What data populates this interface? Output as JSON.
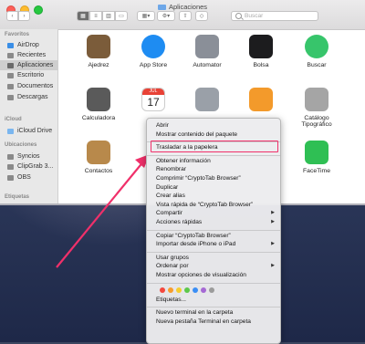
{
  "window": {
    "title": "Aplicaciones"
  },
  "search": {
    "placeholder": "Buscar"
  },
  "sidebar": {
    "sections": [
      {
        "title": "Favoritos",
        "items": [
          "AirDrop",
          "Recientes",
          "Aplicaciones",
          "Escritorio",
          "Documentos",
          "Descargas"
        ]
      },
      {
        "title": "iCloud",
        "items": [
          "iCloud Drive"
        ]
      },
      {
        "title": "Ubicaciones",
        "items": [
          "Syncios",
          "ClipGrab 3...",
          "OBS"
        ]
      },
      {
        "title": "Etiquetas",
        "items": []
      }
    ],
    "selected": "Aplicaciones"
  },
  "apps": [
    {
      "label": "Ajedrez",
      "icon": "chess-knight-icon",
      "color": "#7b5c3a"
    },
    {
      "label": "App Store",
      "icon": "app-store-icon",
      "color": "#1e8cf2"
    },
    {
      "label": "Automator",
      "icon": "automator-robot-icon",
      "color": "#8a8f98"
    },
    {
      "label": "Bolsa",
      "icon": "stocks-chart-icon",
      "color": "#1c1c1e"
    },
    {
      "label": "Buscar",
      "icon": "find-my-radar-icon",
      "color": "#37c56b"
    },
    {
      "label": "Calculadora",
      "icon": "calculator-icon",
      "color": "#5a5a5a"
    },
    {
      "label": "",
      "icon": "calendar-icon",
      "color": "#e84236",
      "day": "17",
      "month": "JUL"
    },
    {
      "label": "",
      "icon": "image-capture-icon",
      "color": "#9aa0a8"
    },
    {
      "label": "",
      "icon": "home-icon",
      "color": "#f39a2b"
    },
    {
      "label": "Catálogo\nTipográfico",
      "icon": "font-book-icon",
      "color": "#a5a5a5"
    },
    {
      "label": "Contactos",
      "icon": "contacts-book-icon",
      "color": "#b8894b"
    },
    {
      "label": "FaceTime",
      "icon": "facetime-camera-icon",
      "color": "#2fbf54"
    }
  ],
  "context_menu": {
    "items": [
      {
        "label": "Abrir"
      },
      {
        "label": "Mostrar contenido del paquete"
      },
      {
        "sep": true
      },
      {
        "label": "Trasladar a la papelera",
        "highlight": true
      },
      {
        "sep": true
      },
      {
        "label": "Obtener información"
      },
      {
        "label": "Renombrar"
      },
      {
        "label": "Comprimir “CryptoTab Browser”"
      },
      {
        "label": "Duplicar"
      },
      {
        "label": "Crear alias"
      },
      {
        "label": "Vista rápida de “CryptoTab Browser”"
      },
      {
        "label": "Compartir",
        "submenu": true
      },
      {
        "label": "Acciones rápidas",
        "submenu": true
      },
      {
        "sep": true
      },
      {
        "label": "Copiar “CryptoTab Browser”"
      },
      {
        "label": "Importar desde iPhone o iPad",
        "submenu": true
      },
      {
        "sep": true
      },
      {
        "label": "Usar grupos"
      },
      {
        "label": "Ordenar por",
        "submenu": true
      },
      {
        "label": "Mostrar opciones de visualización"
      },
      {
        "sep": true
      },
      {
        "tags": true
      },
      {
        "label": "Etiquetas..."
      },
      {
        "sep": true
      },
      {
        "label": "Nuevo terminal en la carpeta"
      },
      {
        "label": "Nueva pestaña Terminal en carpeta"
      }
    ],
    "tag_colors": [
      "#f4483e",
      "#f89c2c",
      "#f5cd2f",
      "#5dc84a",
      "#3b8ef5",
      "#a569d4",
      "#9b9b9b"
    ],
    "highlight_color": "#f0306a"
  },
  "annotation": {
    "arrow_color": "#f0306a"
  }
}
